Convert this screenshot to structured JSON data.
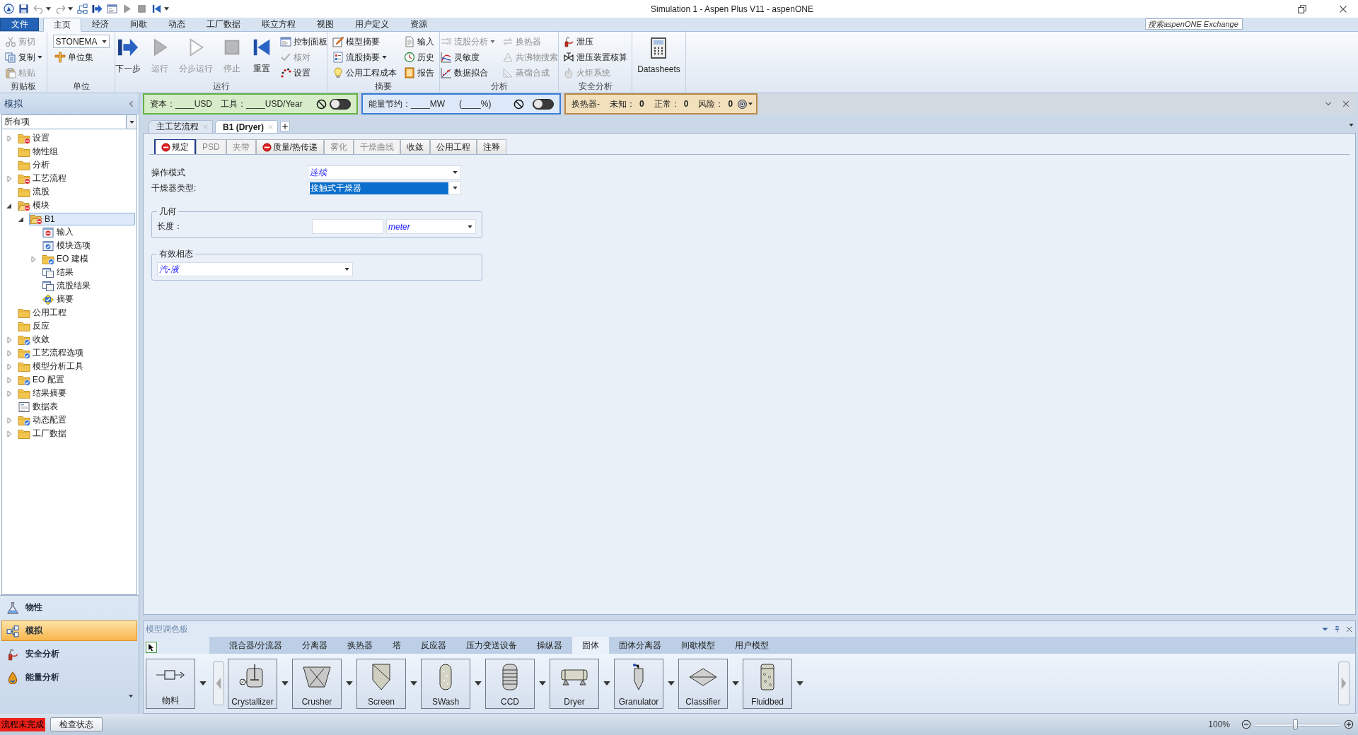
{
  "window": {
    "title": "Simulation 1 - Aspen Plus V11 - aspenONE"
  },
  "ribbon": {
    "tabs": [
      {
        "label": "文件",
        "kind": "file",
        "selected": false
      },
      {
        "label": "主页",
        "kind": "tab",
        "selected": true
      },
      {
        "label": "经济",
        "kind": "tab",
        "selected": false
      },
      {
        "label": "间歇",
        "kind": "tab",
        "selected": false
      },
      {
        "label": "动态",
        "kind": "tab",
        "selected": false
      },
      {
        "label": "工厂数据",
        "kind": "tab",
        "selected": false
      },
      {
        "label": "联立方程",
        "kind": "tab",
        "selected": false
      },
      {
        "label": "视图",
        "kind": "tab",
        "selected": false
      },
      {
        "label": "用户定义",
        "kind": "tab",
        "selected": false
      },
      {
        "label": "资源",
        "kind": "tab",
        "selected": false
      }
    ],
    "search": {
      "placeholder": "搜索aspenONE Exchange"
    },
    "groups": [
      {
        "label": "剪贴板",
        "columns": [
          [
            {
              "kind": "small",
              "label": "剪切",
              "disabled": true
            },
            {
              "kind": "small",
              "label": "复制",
              "disabled": false,
              "menu": true
            },
            {
              "kind": "small",
              "label": "粘贴",
              "disabled": true
            }
          ]
        ]
      },
      {
        "label": "单位",
        "columns": [
          [
            {
              "kind": "select",
              "value": "STONEMA"
            },
            {
              "kind": "small",
              "label": "单位集",
              "disabled": false
            }
          ]
        ]
      },
      {
        "label": "运行",
        "columns": [
          [
            {
              "kind": "large",
              "label": "下一步",
              "disabled": false
            }
          ],
          [
            {
              "kind": "large",
              "label": "运行",
              "disabled": true
            }
          ],
          [
            {
              "kind": "large",
              "label": "分步运行",
              "disabled": true
            }
          ],
          [
            {
              "kind": "large",
              "label": "停止",
              "disabled": true
            }
          ],
          [
            {
              "kind": "large",
              "label": "重置",
              "disabled": false
            }
          ],
          [
            {
              "kind": "small",
              "label": "控制面板",
              "disabled": false
            },
            {
              "kind": "small",
              "label": "核对",
              "disabled": true
            },
            {
              "kind": "small",
              "label": "设置",
              "disabled": false
            }
          ]
        ]
      },
      {
        "label": "摘要",
        "columns": [
          [
            {
              "kind": "small",
              "label": "模型摘要",
              "disabled": false
            },
            {
              "kind": "small",
              "label": "流股摘要",
              "disabled": false,
              "menu": true
            },
            {
              "kind": "small",
              "label": "公用工程成本",
              "disabled": false
            }
          ],
          [
            {
              "kind": "small",
              "label": "输入",
              "disabled": false
            },
            {
              "kind": "small",
              "label": "历史",
              "disabled": false
            },
            {
              "kind": "small",
              "label": "报告",
              "disabled": false
            }
          ]
        ]
      },
      {
        "label": "分析",
        "columns": [
          [
            {
              "kind": "small",
              "label": "流股分析",
              "disabled": true,
              "menu": true
            },
            {
              "kind": "small",
              "label": "灵敏度",
              "disabled": false
            },
            {
              "kind": "small",
              "label": "数据拟合",
              "disabled": false
            }
          ],
          [
            {
              "kind": "small",
              "label": "换热器",
              "disabled": true
            },
            {
              "kind": "small",
              "label": "共沸物搜索",
              "disabled": true
            },
            {
              "kind": "small",
              "label": "蒸馏合成",
              "disabled": true
            }
          ]
        ]
      },
      {
        "label": "安全分析",
        "columns": [
          [
            {
              "kind": "small",
              "label": "泄压",
              "disabled": false
            },
            {
              "kind": "small",
              "label": "泄压装置核算",
              "disabled": false
            },
            {
              "kind": "small",
              "label": "火炬系统",
              "disabled": true
            }
          ]
        ]
      },
      {
        "columns": [
          [
            {
              "kind": "large",
              "label": "Datasheets",
              "disabled": false
            }
          ]
        ]
      }
    ]
  },
  "navigator": {
    "title": "模拟",
    "filter": "所有项",
    "tree": [
      {
        "label": "设置",
        "kind": "folder",
        "incomplete": true,
        "expanded": false,
        "selected": false
      },
      {
        "label": "物性组",
        "kind": "folder",
        "selected": false
      },
      {
        "label": "分析",
        "kind": "folder",
        "selected": false
      },
      {
        "label": "工艺流程",
        "kind": "folder",
        "incomplete": true,
        "expanded": false,
        "selected": false
      },
      {
        "label": "流股",
        "kind": "folder",
        "selected": false
      },
      {
        "label": "模块",
        "kind": "folder",
        "incomplete": true,
        "expanded": true,
        "selected": false,
        "children": [
          {
            "label": "B1",
            "kind": "folder",
            "incomplete": true,
            "expanded": true,
            "selected": true,
            "children": [
              {
                "label": "输入",
                "kind": "form",
                "incomplete": true,
                "selected": false
              },
              {
                "label": "模块选项",
                "kind": "form",
                "complete": true,
                "selected": false
              },
              {
                "label": "EO 建模",
                "kind": "folder",
                "complete": true,
                "expanded": false,
                "selected": false
              },
              {
                "label": "结果",
                "kind": "results",
                "selected": false
              },
              {
                "label": "流股结果",
                "kind": "results",
                "selected": false
              },
              {
                "label": "摘要",
                "kind": "summary",
                "selected": false
              }
            ]
          }
        ]
      },
      {
        "label": "公用工程",
        "kind": "folder",
        "selected": false
      },
      {
        "label": "反应",
        "kind": "folder",
        "selected": false
      },
      {
        "label": "收敛",
        "kind": "folder",
        "complete": true,
        "expanded": false,
        "selected": false
      },
      {
        "label": "工艺流程选项",
        "kind": "folder",
        "complete": true,
        "expanded": false,
        "selected": false
      },
      {
        "label": "模型分析工具",
        "kind": "folder",
        "expanded": false,
        "selected": false
      },
      {
        "label": "EO 配置",
        "kind": "folder",
        "complete": true,
        "expanded": false,
        "selected": false
      },
      {
        "label": "结果摘要",
        "kind": "folder",
        "expanded": false,
        "selected": false
      },
      {
        "label": "数据表",
        "kind": "datasheet",
        "selected": false
      },
      {
        "label": "动态配置",
        "kind": "folder",
        "complete": true,
        "expanded": false,
        "selected": false
      },
      {
        "label": "工厂数据",
        "kind": "folder",
        "expanded": false,
        "selected": false
      }
    ]
  },
  "nav_buttons": [
    {
      "label": "物性",
      "selected": false
    },
    {
      "label": "模拟",
      "selected": true
    },
    {
      "label": "安全分析",
      "selected": false
    },
    {
      "label": "能量分析",
      "selected": false
    }
  ],
  "economics": {
    "capital": "资本：____USD",
    "utilities": "工具：____USD/Year",
    "cost_switch": {
      "on": false
    },
    "energy": "能量节约：____MW",
    "energy_percent": "(____%)",
    "energy_switch": {
      "on": false
    },
    "exchangers": {
      "label": "换热器-",
      "counts": [
        {
          "label": "未知：",
          "value": "0"
        },
        {
          "label": "正常：",
          "value": "0"
        },
        {
          "label": "风险：",
          "value": "0"
        }
      ]
    }
  },
  "documents": {
    "tabs": [
      {
        "label": "主工艺流程",
        "selected": false
      },
      {
        "label": "B1 (Dryer)",
        "selected": true
      }
    ]
  },
  "form": {
    "tabs": [
      {
        "label": "规定",
        "selected": true,
        "incomplete": true,
        "disabled": false
      },
      {
        "label": "PSD",
        "selected": false,
        "incomplete": false,
        "disabled": true
      },
      {
        "label": "夹带",
        "selected": false,
        "incomplete": false,
        "disabled": true
      },
      {
        "label": "质量/热传递",
        "selected": false,
        "incomplete": true,
        "disabled": false
      },
      {
        "label": "雾化",
        "selected": false,
        "incomplete": false,
        "disabled": true
      },
      {
        "label": "干燥曲线",
        "selected": false,
        "incomplete": false,
        "disabled": true
      },
      {
        "label": "收敛",
        "selected": false,
        "incomplete": false,
        "disabled": false
      },
      {
        "label": "公用工程",
        "selected": false,
        "incomplete": false,
        "disabled": false
      },
      {
        "label": "注释",
        "selected": false,
        "incomplete": false,
        "disabled": false
      }
    ],
    "fields": [
      {
        "label": "操作模式",
        "value": "连续",
        "focused": false
      },
      {
        "label": "干燥器类型:",
        "value": "接触式干燥器",
        "focused": true
      }
    ],
    "geometry": {
      "title": "几何",
      "label": "长度：",
      "unit": "meter"
    },
    "phases": {
      "title": "有效相态",
      "value": "汽-液"
    }
  },
  "palette": {
    "title": "模型调色板",
    "tabs": [
      {
        "label": "混合器/分流器",
        "selected": false
      },
      {
        "label": "分离器",
        "selected": false
      },
      {
        "label": "换热器",
        "selected": false
      },
      {
        "label": "塔",
        "selected": false
      },
      {
        "label": "反应器",
        "selected": false
      },
      {
        "label": "压力变送设备",
        "selected": false
      },
      {
        "label": "操纵器",
        "selected": false
      },
      {
        "label": "固体",
        "selected": true
      },
      {
        "label": "固体分离器",
        "selected": false
      },
      {
        "label": "间歇模型",
        "selected": false
      },
      {
        "label": "用户模型",
        "selected": false
      }
    ],
    "stream": "物料",
    "models": [
      {
        "label": "Crystallizer"
      },
      {
        "label": "Crusher"
      },
      {
        "label": "Screen"
      },
      {
        "label": "SWash"
      },
      {
        "label": "CCD"
      },
      {
        "label": "Dryer"
      },
      {
        "label": "Granulator"
      },
      {
        "label": "Classifier"
      },
      {
        "label": "Fluidbed"
      }
    ]
  },
  "status_bar": {
    "status": "流程未完成",
    "check_button": "检查状态",
    "zoom": "100%",
    "zoom_slider": {
      "level": 0.47
    }
  }
}
